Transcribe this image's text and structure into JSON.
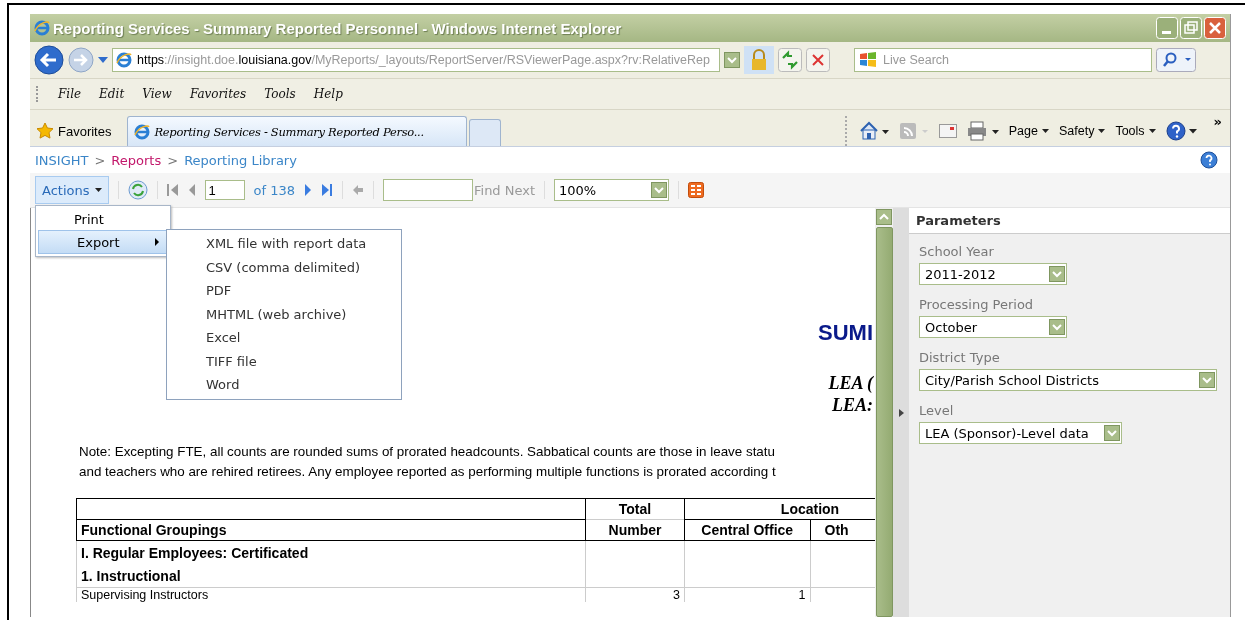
{
  "window": {
    "title": "Reporting Services - Summary Reported Personnel - Windows Internet Explorer"
  },
  "address_bar": {
    "url": [
      {
        "text": "https",
        "emphasis": true
      },
      {
        "text": "://insight.doe.",
        "emphasis": false
      },
      {
        "text": "louisiana.gov",
        "emphasis": true
      },
      {
        "text": "/MyReports/_layouts/ReportServer/RSViewerPage.aspx?rv:RelativeRep",
        "emphasis": false
      }
    ],
    "search_placeholder": "Live Search"
  },
  "menu_bar": [
    "File",
    "Edit",
    "View",
    "Favorites",
    "Tools",
    "Help"
  ],
  "command_bar": {
    "favorites": "Favorites",
    "tab": "Reporting Services - Summary Reported Perso...",
    "tools": [
      "Page",
      "Safety",
      "Tools"
    ],
    "overflow": "»"
  },
  "breadcrumb": [
    {
      "text": "INSIGHT",
      "kind": "link"
    },
    {
      "text": ">",
      "kind": "separator"
    },
    {
      "text": "Reports",
      "kind": "current"
    },
    {
      "text": ">",
      "kind": "separator"
    },
    {
      "text": "Reporting Library",
      "kind": "link"
    }
  ],
  "toolbar": {
    "actions": "Actions",
    "page": "1",
    "page_count": "of 138",
    "find_next": "Find Next",
    "zoom": "100%"
  },
  "actions_menu": [
    {
      "label": "Print",
      "selected": false,
      "submenu": false
    },
    {
      "label": "Export",
      "selected": true,
      "submenu": true
    }
  ],
  "export_menu": [
    "XML file with report data",
    "CSV (comma delimited)",
    "PDF",
    "MHTML (web archive)",
    "Excel",
    "TIFF file",
    "Word"
  ],
  "report": {
    "heading": "SUMI",
    "lea_lines": [
      "LEA (",
      "LEA:"
    ],
    "note": [
      "Note: Excepting FTE, all counts are rounded sums of prorated headcounts. Sabbatical counts are those in leave statu",
      "and teachers who are rehired retirees. Any employee reported as performing multiple functions is prorated according t"
    ],
    "table": {
      "header_top": {
        "total": "Total",
        "location": "Location"
      },
      "header_bottom": [
        "Functional Groupings",
        "Number",
        "Central Office",
        "Oth"
      ],
      "rows": [
        {
          "kind": "section",
          "cells": [
            "I. Regular Employees: Certificated",
            "",
            "",
            ""
          ]
        },
        {
          "kind": "section",
          "cells": [
            "1. Instructional",
            "",
            "",
            ""
          ]
        },
        {
          "kind": "data",
          "cells": [
            "Supervising Instructors",
            "3",
            "1",
            ""
          ]
        }
      ]
    }
  },
  "parameters": {
    "title": "Parameters",
    "fields": [
      {
        "label": "School Year",
        "value": "2011-2012"
      },
      {
        "label": "Processing Period",
        "value": "October"
      },
      {
        "label": "District Type",
        "value": "City/Parish School Districts"
      },
      {
        "label": "Level",
        "value": "LEA (Sponsor)-Level data"
      }
    ]
  }
}
